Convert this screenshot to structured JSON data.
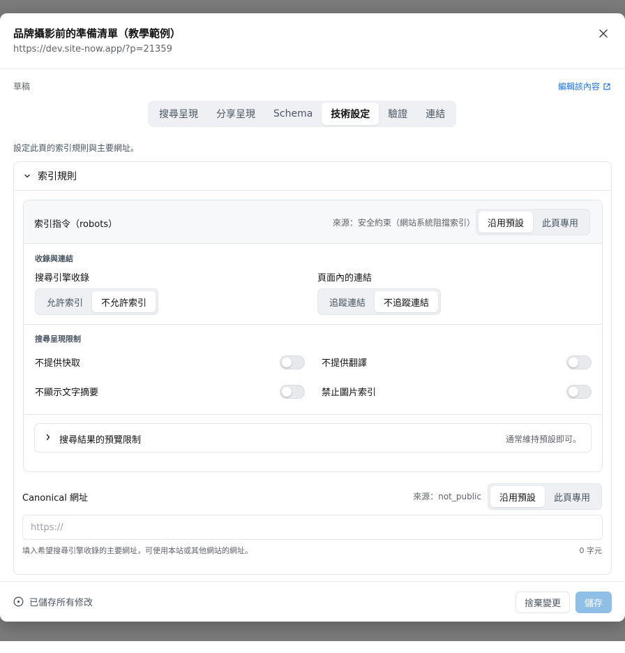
{
  "modal": {
    "title": "品牌攝影前的準備清單（教學範例）",
    "url": "https://dev.site-now.app/?p=21359",
    "close_icon": "close-icon"
  },
  "status": {
    "label": "草稿",
    "edit_link": "編輯該內容",
    "edit_icon": "external-link-icon"
  },
  "tabs": [
    {
      "label": "搜尋呈現",
      "active": false
    },
    {
      "label": "分享呈現",
      "active": false
    },
    {
      "label": "Schema",
      "active": false
    },
    {
      "label": "技術設定",
      "active": true
    },
    {
      "label": "驗證",
      "active": false
    },
    {
      "label": "連結",
      "active": false
    }
  ],
  "description": "設定此頁的索引規則與主要網址。",
  "index_rules": {
    "title": "索引規則",
    "robots": {
      "title": "索引指令（robots）",
      "source": "來源：安全約束（網站系統阻擋索引）",
      "mode_options": [
        "沿用預設",
        "此頁專用"
      ],
      "mode_selected": "沿用預設"
    },
    "indexing": {
      "section_label": "收錄與連結",
      "search_engine": {
        "label": "搜尋引擎收錄",
        "options": [
          "允許索引",
          "不允許索引"
        ],
        "selected": "不允許索引"
      },
      "links": {
        "label": "頁面內的連結",
        "options": [
          "追蹤連結",
          "不追蹤連結"
        ],
        "selected": "不追蹤連結"
      }
    },
    "display_limits": {
      "section_label": "搜尋呈現限制",
      "toggles": [
        {
          "label": "不提供快取",
          "on": false
        },
        {
          "label": "不提供翻譯",
          "on": false
        },
        {
          "label": "不顯示文字摘要",
          "on": false
        },
        {
          "label": "禁止圖片索引",
          "on": false
        }
      ]
    },
    "preview_limits": {
      "title": "搜尋結果的預覽限制",
      "hint": "通常維持預設即可。"
    }
  },
  "canonical": {
    "title": "Canonical 網址",
    "source": "來源：not_public",
    "mode_options": [
      "沿用預設",
      "此頁專用"
    ],
    "mode_selected": "沿用預設",
    "placeholder": "https://",
    "value": "",
    "help": "填入希望搜尋引擎收錄的主要網址，可使用本站或其他網站的網址。",
    "count": "0 字元"
  },
  "footer": {
    "saved_status": "已儲存所有修改",
    "discard_label": "捨棄變更",
    "save_label": "儲存"
  },
  "colors": {
    "accent": "#1a73e8",
    "save_button": "#8fbfe6",
    "backdrop": "#7b7b7b"
  }
}
